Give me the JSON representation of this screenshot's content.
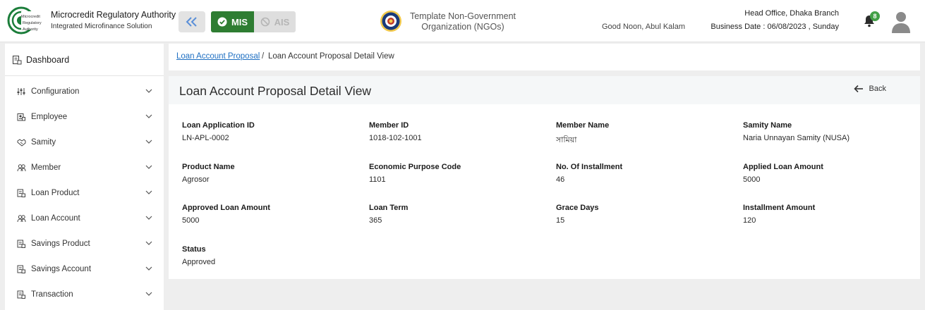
{
  "header": {
    "brand_title": "Microcredit Regulatory Authority",
    "brand_subtitle": "Integrated Microfinance Solution",
    "logo_text": "Microcredit Regulatory Authority",
    "mis_label": "MIS",
    "ais_label": "AIS",
    "org_name_line1": "Template Non-Government",
    "org_name_line2": "Organization (NGOs)",
    "greeting": "Good Noon, Abul Kalam",
    "branch": "Head Office, Dhaka Branch",
    "business_date": "Business Date : 06/08/2023 , Sunday",
    "notification_count": "8",
    "accent_color": "#2e7d32"
  },
  "sidebar": {
    "dashboard": "Dashboard",
    "items": [
      {
        "label": "Configuration",
        "icon": "sliders-icon"
      },
      {
        "label": "Employee",
        "icon": "id-card-icon"
      },
      {
        "label": "Samity",
        "icon": "handshake-icon"
      },
      {
        "label": "Member",
        "icon": "users-icon"
      },
      {
        "label": "Loan Product",
        "icon": "document-icon"
      },
      {
        "label": "Loan Account",
        "icon": "users-icon"
      },
      {
        "label": "Savings Product",
        "icon": "document-icon"
      },
      {
        "label": "Savings Account",
        "icon": "document-icon"
      },
      {
        "label": "Transaction",
        "icon": "document-icon"
      }
    ]
  },
  "breadcrumb": {
    "link": "Loan Account Proposal",
    "separator": "/",
    "current": "Loan Account Proposal Detail View"
  },
  "detail": {
    "title": "Loan Account Proposal Detail View",
    "back_label": "Back",
    "fields": [
      {
        "label": "Loan Application ID",
        "value": "LN-APL-0002"
      },
      {
        "label": "Member ID",
        "value": "1018-102-1001"
      },
      {
        "label": "Member Name",
        "value": "সামিয়া"
      },
      {
        "label": "Samity Name",
        "value": "Naria Unnayan Samity (NUSA)"
      },
      {
        "label": "Product Name",
        "value": "Agrosor"
      },
      {
        "label": "Economic Purpose Code",
        "value": "1101"
      },
      {
        "label": "No. Of Installment",
        "value": "46"
      },
      {
        "label": "Applied Loan Amount",
        "value": "5000"
      },
      {
        "label": "Approved Loan Amount",
        "value": "5000"
      },
      {
        "label": "Loan Term",
        "value": "365"
      },
      {
        "label": "Grace Days",
        "value": "15"
      },
      {
        "label": "Installment Amount",
        "value": "120"
      },
      {
        "label": "Status",
        "value": "Approved"
      }
    ]
  }
}
